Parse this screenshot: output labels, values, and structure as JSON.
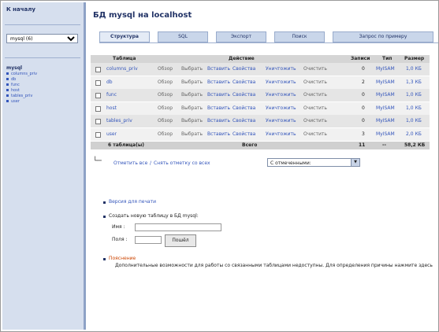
{
  "left": {
    "home_label": "К началу",
    "db_select_value": "mysql (6)",
    "db_name": "mysql",
    "tables": [
      "columns_priv",
      "db",
      "func",
      "host",
      "tables_priv",
      "user"
    ]
  },
  "page": {
    "title": "БД mysql на localhost"
  },
  "tabs": [
    "Структура",
    "SQL",
    "Экспорт",
    "Поиск",
    "Запрос по примеру"
  ],
  "table": {
    "headers": [
      "Таблица",
      "Действие",
      "Записи",
      "Тип",
      "Размер"
    ],
    "rows": [
      {
        "name": "columns_priv",
        "records": "0",
        "type": "MyISAM",
        "size": "1,0 КБ"
      },
      {
        "name": "db",
        "records": "2",
        "type": "MyISAM",
        "size": "1,3 КБ"
      },
      {
        "name": "func",
        "records": "0",
        "type": "MyISAM",
        "size": "1,0 КБ"
      },
      {
        "name": "host",
        "records": "0",
        "type": "MyISAM",
        "size": "1,0 КБ"
      },
      {
        "name": "tables_priv",
        "records": "0",
        "type": "MyISAM",
        "size": "1,0 КБ"
      },
      {
        "name": "user",
        "records": "3",
        "type": "MyISAM",
        "size": "2,0 КБ"
      }
    ],
    "actions": [
      "Обзор",
      "Выбрать",
      "Вставить",
      "Свойства",
      "Уничтожить",
      "Очистить"
    ],
    "footer": {
      "count_label": "6 таблица(ы)",
      "sum_label": "Всего",
      "records": "11",
      "type": "--",
      "size": "58,2 КБ"
    }
  },
  "below_table": {
    "check_all": "Отметить все",
    "uncheck_all": "Снять отметку со всех",
    "with_selected": "С отмеченными:"
  },
  "ops": {
    "print_view": "Версия для печати",
    "create_table": "Создать новую таблицу в БД mysql:",
    "name_label": "Имя :",
    "fields_label": "Поля :",
    "go_button": "Пошёл",
    "tip_title": "Пояснение",
    "tip_text": "Дополнительные возможности для работы со связанными таблицами недоступны. Для определения причины нажмите здесь"
  }
}
